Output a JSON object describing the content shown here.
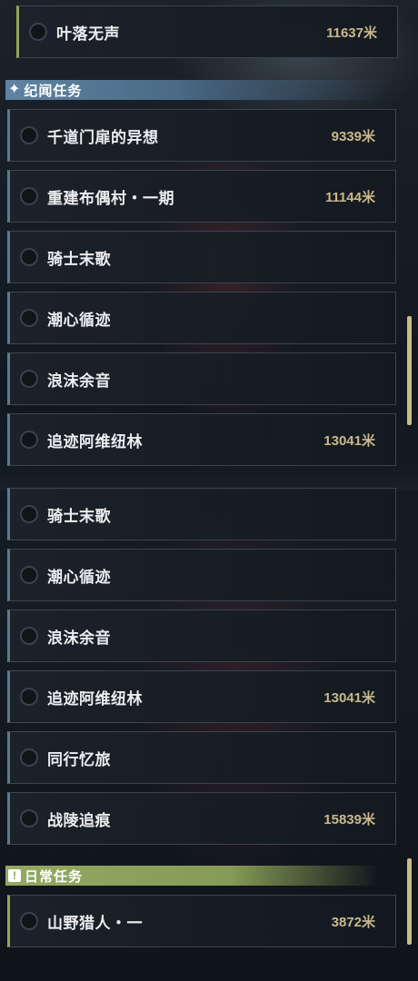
{
  "top_quest": {
    "title": "叶落无声",
    "distance": "11637米"
  },
  "chronicle_section": {
    "label": "纪闻任务",
    "icon": "sparkle-star-icon"
  },
  "chronicle_upper": [
    {
      "title": "千道门扉的异想",
      "distance": "9339米"
    },
    {
      "title": "重建布偶村・一期",
      "distance": "11144米"
    },
    {
      "title": "骑士末歌",
      "distance": ""
    },
    {
      "title": "潮心循迹",
      "distance": ""
    },
    {
      "title": "浪沫余音",
      "distance": ""
    },
    {
      "title": "追迹阿维纽林",
      "distance": "13041米"
    }
  ],
  "chronicle_lower": [
    {
      "title": "骑士末歌",
      "distance": ""
    },
    {
      "title": "潮心循迹",
      "distance": ""
    },
    {
      "title": "浪沫余音",
      "distance": ""
    },
    {
      "title": "追迹阿维纽林",
      "distance": "13041米"
    },
    {
      "title": "同行忆旅",
      "distance": ""
    },
    {
      "title": "战陵追痕",
      "distance": "15839米"
    }
  ],
  "daily_section": {
    "label": "日常任务",
    "icon": "exclamation-icon"
  },
  "daily_quests": [
    {
      "title": "山野猎人・一",
      "distance": "3872米"
    }
  ],
  "colors": {
    "chronicle_accent": "#5e7a8e",
    "daily_accent": "#93a55e",
    "distance_text": "#c9b98a",
    "scrollbar": "#c8bd82"
  }
}
